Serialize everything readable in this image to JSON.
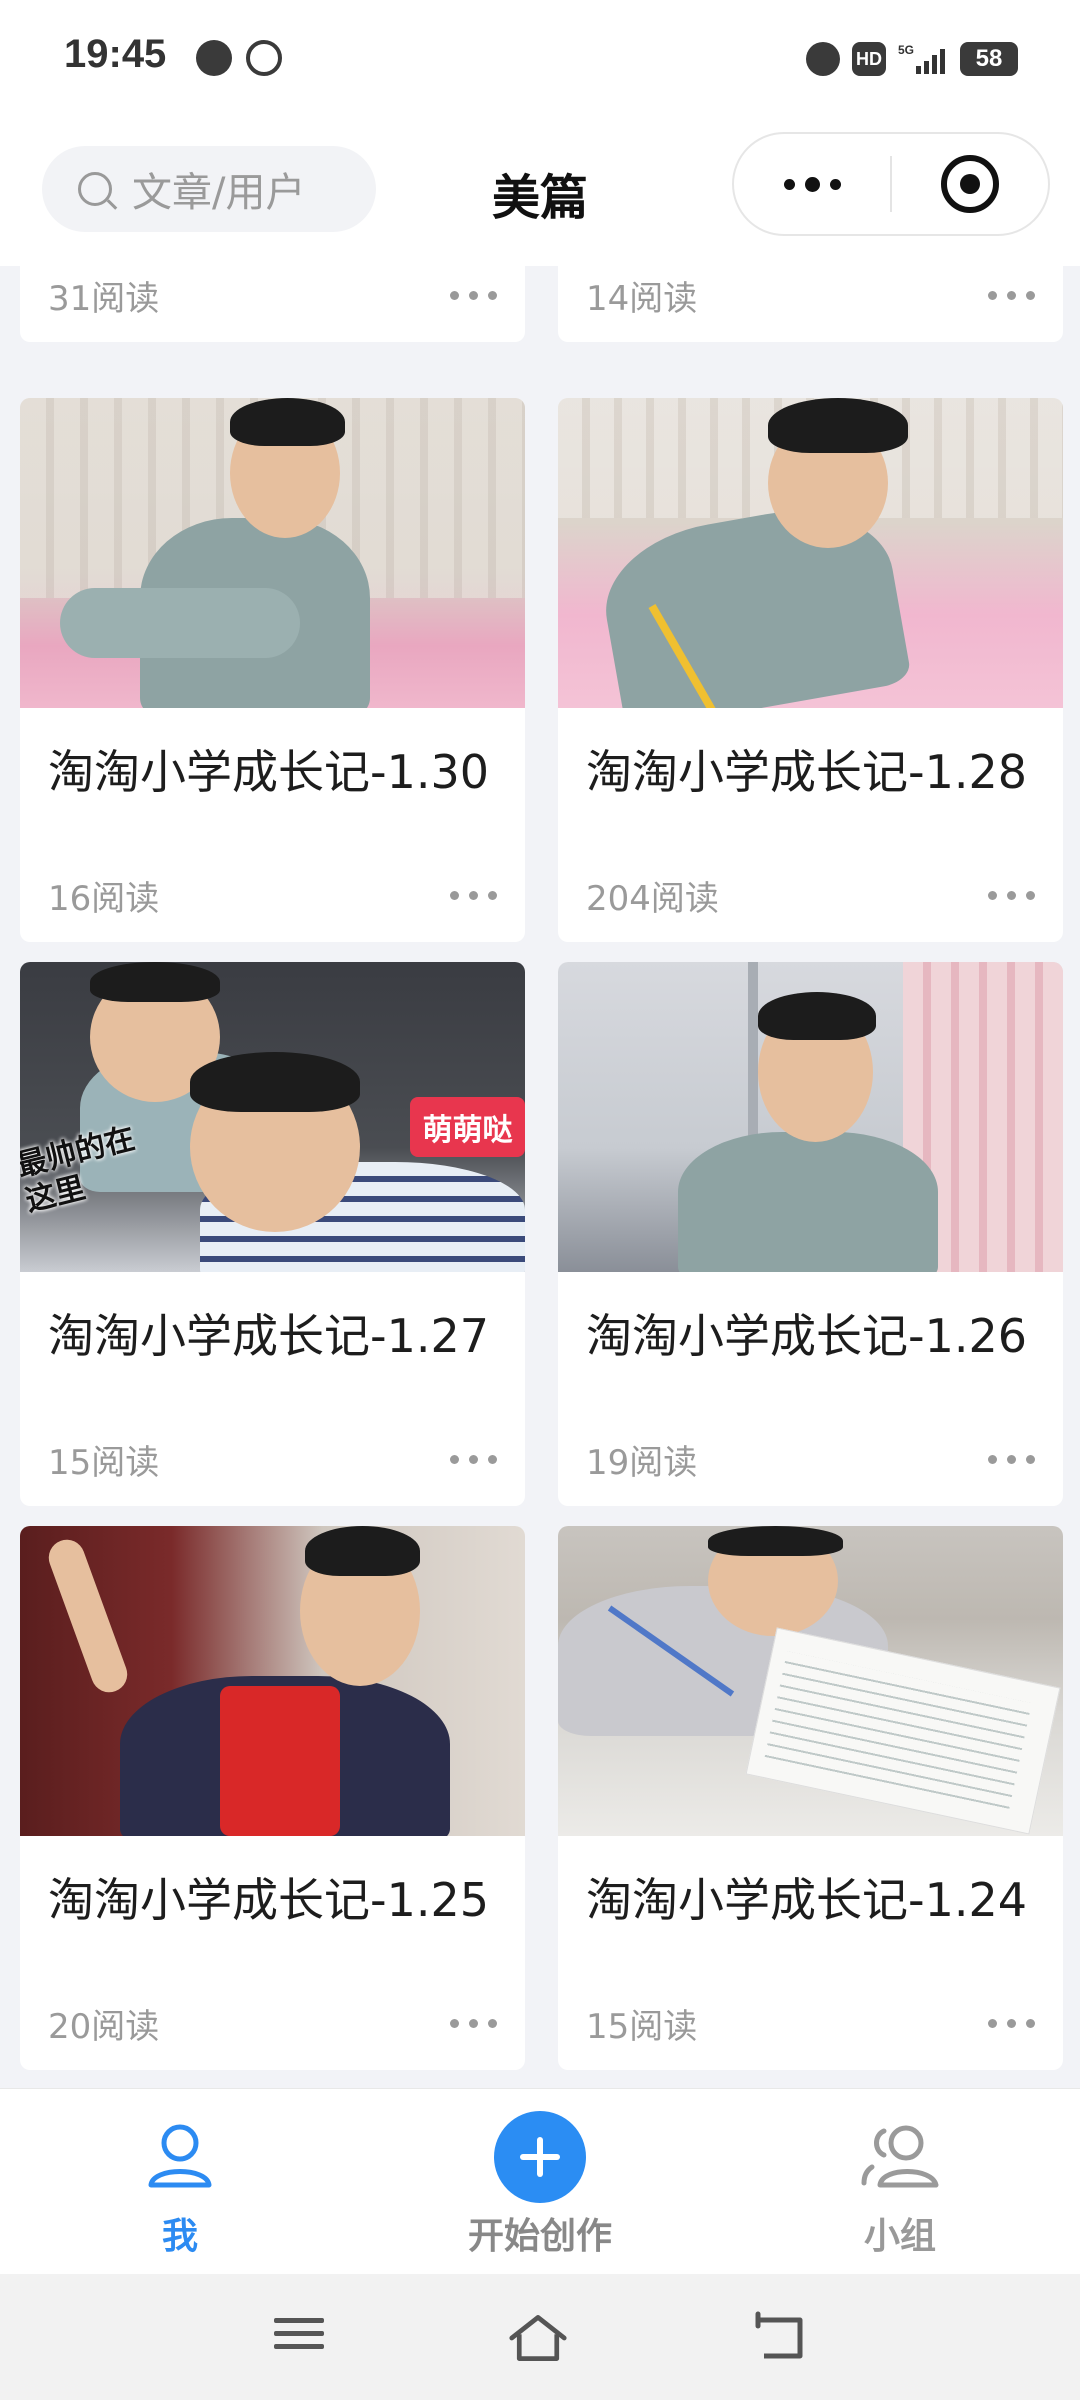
{
  "status_bar": {
    "time": "19:45",
    "left_icons": [
      "wechat-icon",
      "data-saver-icon"
    ],
    "right_icons": [
      "alarm-icon",
      "hd-icon",
      "signal-5g-icon",
      "battery-icon"
    ],
    "hd_label": "HD",
    "signal_label": "5G",
    "battery": "58"
  },
  "nav": {
    "search_placeholder": "文章/用户",
    "title": "美篇",
    "more_icon": "more-dots-icon",
    "close_icon": "target-icon"
  },
  "partial_cards": [
    {
      "reads": "31阅读"
    },
    {
      "reads": "14阅读"
    }
  ],
  "cards": [
    {
      "title": "淘淘小学成长记-1.30",
      "reads": "16阅读"
    },
    {
      "title": "淘淘小学成长记-1.28",
      "reads": "204阅读"
    },
    {
      "title": "淘淘小学成长记-1.27",
      "reads": "15阅读",
      "sticker_text": "萌萌哒",
      "overlay_text": "最帅的在这里"
    },
    {
      "title": "淘淘小学成长记-1.26",
      "reads": "19阅读"
    },
    {
      "title": "淘淘小学成长记-1.25",
      "reads": "20阅读"
    },
    {
      "title": "淘淘小学成长记-1.24",
      "reads": "15阅读"
    }
  ],
  "tabs": [
    {
      "label": "我",
      "icon": "user-icon",
      "active": true
    },
    {
      "label": "开始创作",
      "icon": "plus-icon",
      "active": false
    },
    {
      "label": "小组",
      "icon": "group-icon",
      "active": false
    }
  ],
  "colors": {
    "accent": "#2b8df3",
    "background": "#f2f3f7",
    "muted_text": "#9a9a9a"
  }
}
